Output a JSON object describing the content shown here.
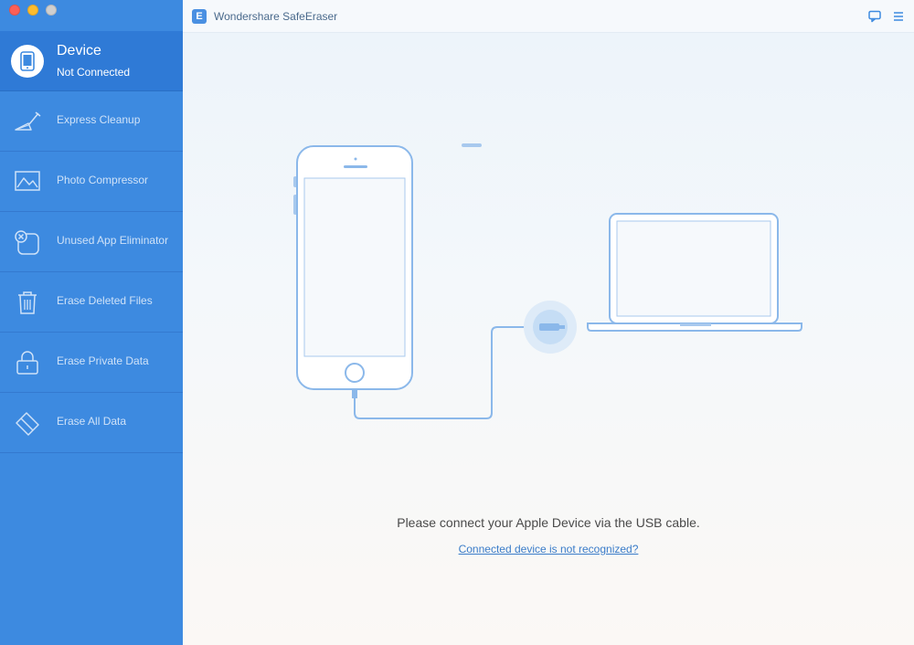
{
  "window": {
    "controls": [
      "close",
      "minimize",
      "maximize"
    ]
  },
  "app": {
    "title": "Wondershare SafeEraser",
    "logo_letter": "E"
  },
  "device": {
    "title": "Device",
    "status": "Not Connected"
  },
  "sidebar": {
    "items": [
      {
        "label": "Express Cleanup",
        "icon": "broom-icon"
      },
      {
        "label": "Photo Compressor",
        "icon": "photo-icon"
      },
      {
        "label": "Unused App Eliminator",
        "icon": "app-remove-icon"
      },
      {
        "label": "Erase Deleted Files",
        "icon": "trash-icon"
      },
      {
        "label": "Erase Private Data",
        "icon": "lock-icon"
      },
      {
        "label": "Erase All Data",
        "icon": "eraser-icon"
      }
    ]
  },
  "toolbar": {
    "icons": [
      "feedback-icon",
      "menu-icon"
    ]
  },
  "main": {
    "prompt": "Please connect your Apple Device via the USB cable.",
    "help_link": "Connected device is not recognized?"
  },
  "colors": {
    "sidebar": "#3d8ae0",
    "sidebar_active": "#2f7ad6",
    "accent": "#4a90e2",
    "link": "#3a7cc9"
  }
}
